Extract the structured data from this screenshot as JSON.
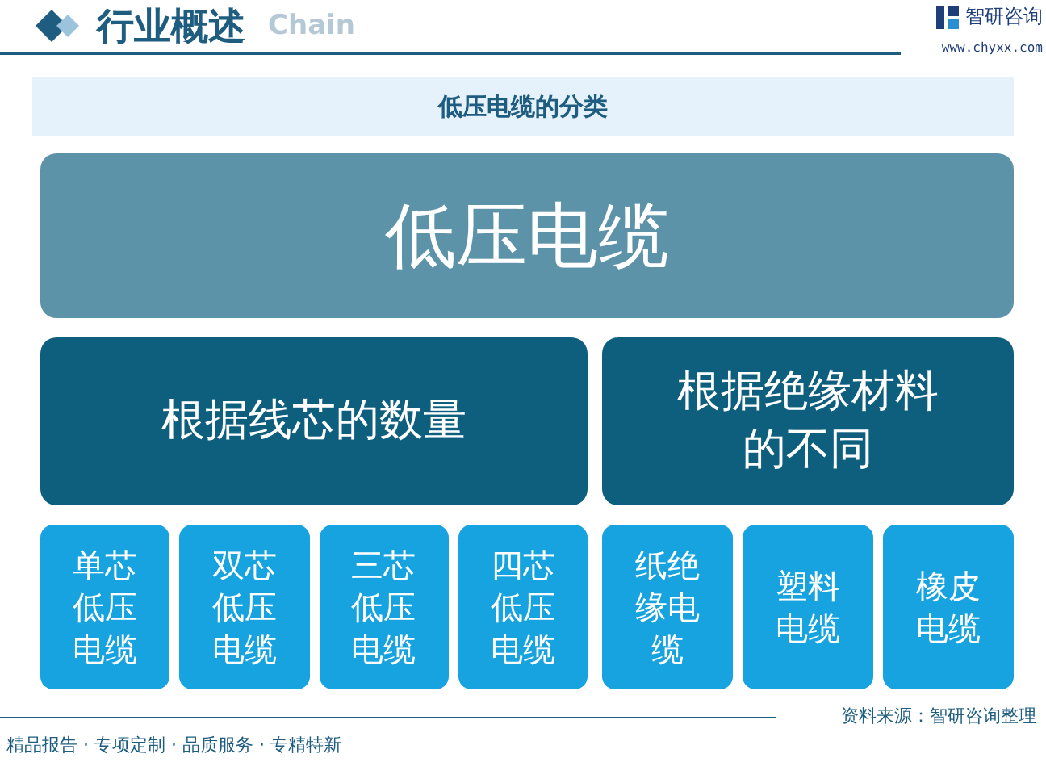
{
  "header": {
    "title": "行业概述",
    "ghost": "Chain",
    "brand": "智研咨询",
    "url": "www.chyxx.com"
  },
  "chart_title": "低压电缆的分类",
  "root": "低压电缆",
  "groups": [
    {
      "label": "根据线芯的数量",
      "children": [
        "单芯低压电缆",
        "双芯低压电缆",
        "三芯低压电缆",
        "四芯低压电缆"
      ]
    },
    {
      "label": "根据绝缘材料的不同",
      "children": [
        "纸绝缘电缆",
        "塑料电缆",
        "橡皮电缆"
      ]
    }
  ],
  "source": "资料来源：智研咨询整理",
  "footer": "精品报告 · 专项定制 · 品质服务 · 专精特新"
}
